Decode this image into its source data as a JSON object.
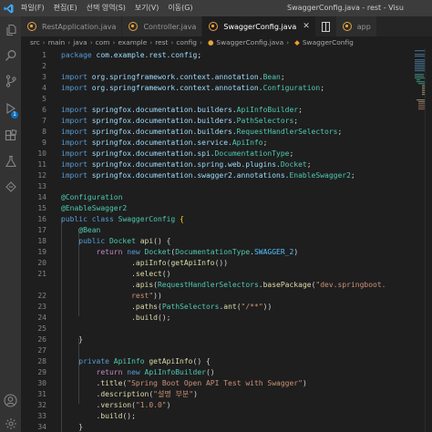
{
  "titlebar": {
    "menus": [
      "파일(F)",
      "편집(E)",
      "선택 영역(S)",
      "보기(V)",
      "이동(G)"
    ],
    "window_title": "SwaggerConfig.java - rest - Visu"
  },
  "colors": {
    "accent": "#0e70c0",
    "java_icon": "#e8a33d"
  },
  "activitybar": {
    "icons": [
      "files-icon",
      "search-icon",
      "source-control-icon",
      "run-debug-icon",
      "extensions-icon",
      "testing-icon",
      "remote-icon",
      "account-icon",
      "settings-icon"
    ],
    "run_badge": "1"
  },
  "tabs": [
    {
      "label": "RestApplication.java",
      "active": false
    },
    {
      "label": "Controller.java",
      "active": false
    },
    {
      "label": "SwaggerConfig.java",
      "active": true
    },
    {
      "label": "app",
      "active": false
    }
  ],
  "breadcrumb": [
    "src",
    "main",
    "java",
    "com",
    "example",
    "rest",
    "config",
    "SwaggerConfig.java",
    "SwaggerConfig"
  ],
  "editor": {
    "line_numbers": [
      "1",
      "2",
      "3",
      "4",
      "5",
      "6",
      "7",
      "8",
      "9",
      "10",
      "11",
      "12",
      "13",
      "14",
      "15",
      "16",
      "17",
      "18",
      "19",
      "20",
      "21",
      "",
      "22",
      "23",
      "24",
      "25",
      "26",
      "27",
      "28",
      "29",
      "30",
      "31",
      "32",
      "33",
      "34",
      "35"
    ],
    "lines": [
      [
        {
          "t": "package ",
          "c": "kw"
        },
        {
          "t": "com.example.rest.config",
          "c": "ns"
        },
        {
          "t": ";",
          "c": "pl"
        }
      ],
      [],
      [
        {
          "t": "import ",
          "c": "kw"
        },
        {
          "t": "org.springframework.context.annotation.",
          "c": "ns"
        },
        {
          "t": "Bean",
          "c": "ty"
        },
        {
          "t": ";",
          "c": "pl"
        }
      ],
      [
        {
          "t": "import ",
          "c": "kw"
        },
        {
          "t": "org.springframework.context.annotation.",
          "c": "ns"
        },
        {
          "t": "Configuration",
          "c": "ty"
        },
        {
          "t": ";",
          "c": "pl"
        }
      ],
      [],
      [
        {
          "t": "import ",
          "c": "kw"
        },
        {
          "t": "springfox.documentation.builders.",
          "c": "ns"
        },
        {
          "t": "ApiInfoBuilder",
          "c": "ty"
        },
        {
          "t": ";",
          "c": "pl"
        }
      ],
      [
        {
          "t": "import ",
          "c": "kw"
        },
        {
          "t": "springfox.documentation.builders.",
          "c": "ns"
        },
        {
          "t": "PathSelectors",
          "c": "ty"
        },
        {
          "t": ";",
          "c": "pl"
        }
      ],
      [
        {
          "t": "import ",
          "c": "kw"
        },
        {
          "t": "springfox.documentation.builders.",
          "c": "ns"
        },
        {
          "t": "RequestHandlerSelectors",
          "c": "ty"
        },
        {
          "t": ";",
          "c": "pl"
        }
      ],
      [
        {
          "t": "import ",
          "c": "kw"
        },
        {
          "t": "springfox.documentation.service.",
          "c": "ns"
        },
        {
          "t": "ApiInfo",
          "c": "ty"
        },
        {
          "t": ";",
          "c": "pl"
        }
      ],
      [
        {
          "t": "import ",
          "c": "kw"
        },
        {
          "t": "springfox.documentation.spi.",
          "c": "ns"
        },
        {
          "t": "DocumentationType",
          "c": "ty"
        },
        {
          "t": ";",
          "c": "pl"
        }
      ],
      [
        {
          "t": "import ",
          "c": "kw"
        },
        {
          "t": "springfox.documentation.spring.web.plugins.",
          "c": "ns"
        },
        {
          "t": "Docket",
          "c": "ty"
        },
        {
          "t": ";",
          "c": "pl"
        }
      ],
      [
        {
          "t": "import ",
          "c": "kw"
        },
        {
          "t": "springfox.documentation.swagger2.annotations.",
          "c": "ns"
        },
        {
          "t": "EnableSwagger2",
          "c": "ty"
        },
        {
          "t": ";",
          "c": "pl"
        }
      ],
      [],
      [
        {
          "t": "@Configuration",
          "c": "ty"
        }
      ],
      [
        {
          "t": "@EnableSwagger2",
          "c": "ty"
        }
      ],
      [
        {
          "t": "public ",
          "c": "kw"
        },
        {
          "t": "class ",
          "c": "kw"
        },
        {
          "t": "SwaggerConfig ",
          "c": "ty"
        },
        {
          "t": "{",
          "c": "br"
        }
      ],
      [
        {
          "t": "    @Bean",
          "c": "ty"
        }
      ],
      [
        {
          "t": "    public ",
          "c": "kw"
        },
        {
          "t": "Docket ",
          "c": "ty"
        },
        {
          "t": "api",
          "c": "fn"
        },
        {
          "t": "() {",
          "c": "pl"
        }
      ],
      [
        {
          "t": "        return ",
          "c": "an"
        },
        {
          "t": "new ",
          "c": "kw"
        },
        {
          "t": "Docket",
          "c": "ty"
        },
        {
          "t": "(",
          "c": "pl"
        },
        {
          "t": "DocumentationType",
          "c": "ty"
        },
        {
          "t": ".",
          "c": "pl"
        },
        {
          "t": "SWAGGER_2",
          "c": "cn"
        },
        {
          "t": ")",
          "c": "pl"
        }
      ],
      [
        {
          "t": "                .",
          "c": "pl"
        },
        {
          "t": "apiInfo",
          "c": "fn"
        },
        {
          "t": "(",
          "c": "pl"
        },
        {
          "t": "getApiInfo",
          "c": "fn"
        },
        {
          "t": "())",
          "c": "pl"
        }
      ],
      [
        {
          "t": "                .",
          "c": "pl"
        },
        {
          "t": "select",
          "c": "fn"
        },
        {
          "t": "()",
          "c": "pl"
        }
      ],
      [
        {
          "t": "                .",
          "c": "pl"
        },
        {
          "t": "apis",
          "c": "fn"
        },
        {
          "t": "(",
          "c": "pl"
        },
        {
          "t": "RequestHandlerSelectors",
          "c": "ty"
        },
        {
          "t": ".",
          "c": "pl"
        },
        {
          "t": "basePackage",
          "c": "fn"
        },
        {
          "t": "(",
          "c": "pl"
        },
        {
          "t": "\"dev.springboot.",
          "c": "st"
        }
      ],
      [
        {
          "t": "                rest\"",
          "c": "st"
        },
        {
          "t": "))",
          "c": "pl"
        }
      ],
      [
        {
          "t": "                .",
          "c": "pl"
        },
        {
          "t": "paths",
          "c": "fn"
        },
        {
          "t": "(",
          "c": "pl"
        },
        {
          "t": "PathSelectors",
          "c": "ty"
        },
        {
          "t": ".",
          "c": "pl"
        },
        {
          "t": "ant",
          "c": "fn"
        },
        {
          "t": "(",
          "c": "pl"
        },
        {
          "t": "\"/**\"",
          "c": "st"
        },
        {
          "t": "))",
          "c": "pl"
        }
      ],
      [
        {
          "t": "                .",
          "c": "pl"
        },
        {
          "t": "build",
          "c": "fn"
        },
        {
          "t": "();",
          "c": "pl"
        }
      ],
      [],
      [
        {
          "t": "    }",
          "c": "pl"
        }
      ],
      [],
      [
        {
          "t": "    private ",
          "c": "kw"
        },
        {
          "t": "ApiInfo ",
          "c": "ty"
        },
        {
          "t": "getApiInfo",
          "c": "fn"
        },
        {
          "t": "() {",
          "c": "pl"
        }
      ],
      [
        {
          "t": "        return ",
          "c": "an"
        },
        {
          "t": "new ",
          "c": "kw"
        },
        {
          "t": "ApiInfoBuilder",
          "c": "ty"
        },
        {
          "t": "()",
          "c": "pl"
        }
      ],
      [
        {
          "t": "        .",
          "c": "pl"
        },
        {
          "t": "title",
          "c": "fn"
        },
        {
          "t": "(",
          "c": "pl"
        },
        {
          "t": "\"Spring Boot Open API Test with Swagger\"",
          "c": "st"
        },
        {
          "t": ")",
          "c": "pl"
        }
      ],
      [
        {
          "t": "        .",
          "c": "pl"
        },
        {
          "t": "description",
          "c": "fn"
        },
        {
          "t": "(",
          "c": "pl"
        },
        {
          "t": "\"설명 부분\"",
          "c": "st"
        },
        {
          "t": ")",
          "c": "pl"
        }
      ],
      [
        {
          "t": "        .",
          "c": "pl"
        },
        {
          "t": "version",
          "c": "fn"
        },
        {
          "t": "(",
          "c": "pl"
        },
        {
          "t": "\"1.0.0\"",
          "c": "st"
        },
        {
          "t": ")",
          "c": "pl"
        }
      ],
      [
        {
          "t": "        .",
          "c": "pl"
        },
        {
          "t": "build",
          "c": "fn"
        },
        {
          "t": "();",
          "c": "pl"
        }
      ],
      [
        {
          "t": "    }",
          "c": "pl"
        }
      ],
      [
        {
          "t": "}",
          "c": "br"
        }
      ]
    ]
  }
}
